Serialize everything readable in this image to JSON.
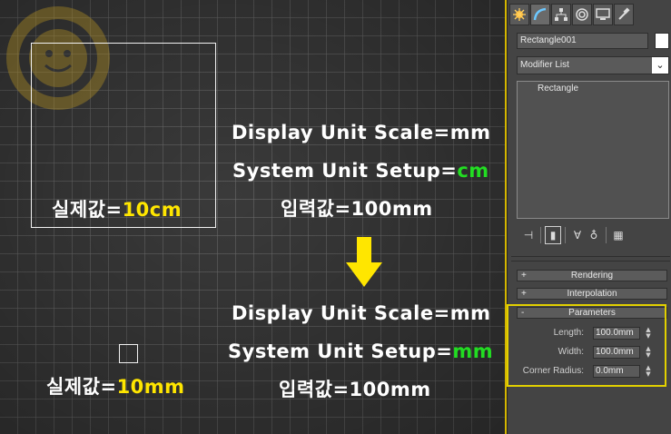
{
  "viewport": {
    "annotations": {
      "top": {
        "line1": "Display Unit Scale=mm",
        "line2_prefix": "System Unit Setup=",
        "line2_unit": "cm",
        "line3": "입력값=100mm",
        "actual_prefix": "실제값=",
        "actual_value": "10cm"
      },
      "bottom": {
        "line1": "Display Unit Scale=mm",
        "line2_prefix": "System Unit Setup=",
        "line2_unit": "mm",
        "line3": "입력값=100mm",
        "actual_prefix": "실제값=",
        "actual_value": "10mm"
      }
    },
    "arrow_icon": "down-arrow-icon",
    "colors": {
      "highlight_yellow": "#ffe600",
      "highlight_green": "#22dd22",
      "grid_bg": "#3a3a3a"
    }
  },
  "panel": {
    "tabs": [
      {
        "icon": "create-icon"
      },
      {
        "icon": "modify-icon"
      },
      {
        "icon": "hierarchy-icon"
      },
      {
        "icon": "motion-icon"
      },
      {
        "icon": "display-icon"
      },
      {
        "icon": "utilities-icon"
      }
    ],
    "object_name": "Rectangle001",
    "modifier_list": "Modifier List",
    "stack_items": [
      "Rectangle"
    ],
    "rollouts": {
      "rendering": "Rendering",
      "interpolation": "Interpolation",
      "parameters": "Parameters"
    },
    "params": [
      {
        "label": "Length:",
        "value": "100.0mm"
      },
      {
        "label": "Width:",
        "value": "100.0mm"
      },
      {
        "label": "Corner Radius:",
        "value": "0.0mm"
      }
    ],
    "accent": "#e2d000"
  }
}
